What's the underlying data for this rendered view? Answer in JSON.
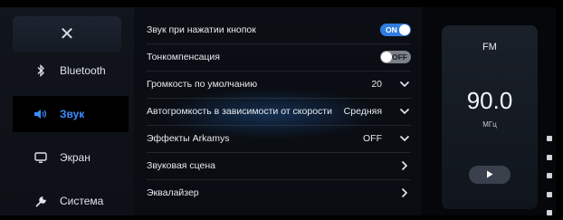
{
  "sidebar": {
    "close_icon": "close-icon",
    "items": [
      {
        "label": "Bluetooth",
        "icon": "bluetooth-icon",
        "active": false
      },
      {
        "label": "Звук",
        "icon": "speaker-icon",
        "active": true
      },
      {
        "label": "Экран",
        "icon": "monitor-icon",
        "active": false
      },
      {
        "label": "Система",
        "icon": "wrench-icon",
        "active": false
      }
    ]
  },
  "settings": {
    "rows": [
      {
        "label": "Звук при нажатии кнопок",
        "control": "toggle",
        "state": "ON"
      },
      {
        "label": "Тонкомпенсация",
        "control": "toggle",
        "state": "OFF"
      },
      {
        "label": "Громкость по умолчанию",
        "value": "20",
        "control": "dropdown"
      },
      {
        "label": "Автогромкость в зависимости от скорости",
        "value": "Средняя",
        "control": "dropdown"
      },
      {
        "label": "Эффекты Arkamys",
        "value": "OFF",
        "control": "dropdown"
      },
      {
        "label": "Звуковая сцена",
        "control": "link"
      },
      {
        "label": "Эквалайзер",
        "control": "link"
      }
    ]
  },
  "radio": {
    "band": "FM",
    "frequency": "90.0",
    "unit": "МГц",
    "play_icon": "play-icon"
  },
  "colors": {
    "accent": "#3b8cff",
    "toggle_on": "#2f7de0",
    "toggle_off": "#7c8089"
  }
}
